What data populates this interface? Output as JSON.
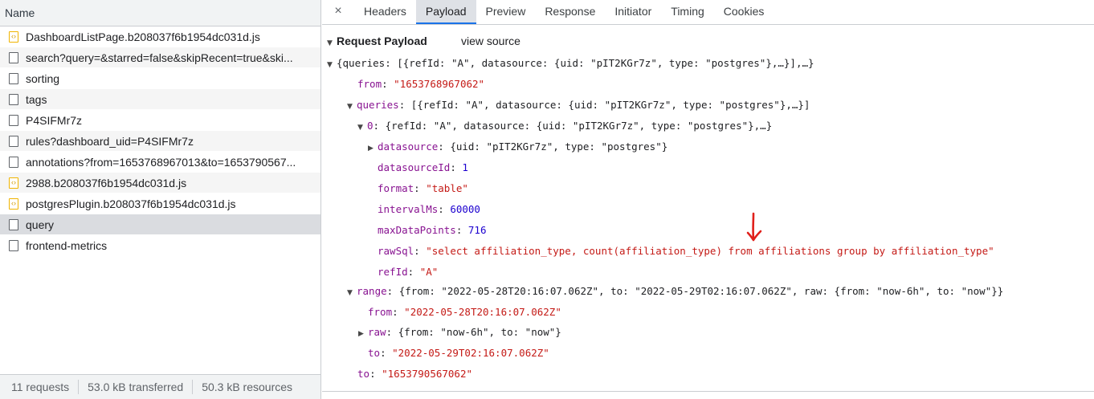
{
  "left_panel": {
    "header": "Name",
    "requests": [
      {
        "name": "DashboardListPage.b208037f6b1954dc031d.js",
        "icon": "js-file-icon"
      },
      {
        "name": "search?query=&starred=false&skipRecent=true&ski...",
        "icon": "document-icon"
      },
      {
        "name": "sorting",
        "icon": "document-icon"
      },
      {
        "name": "tags",
        "icon": "document-icon"
      },
      {
        "name": "P4SIFMr7z",
        "icon": "document-icon"
      },
      {
        "name": "rules?dashboard_uid=P4SIFMr7z",
        "icon": "document-icon"
      },
      {
        "name": "annotations?from=1653768967013&to=1653790567...",
        "icon": "document-icon"
      },
      {
        "name": "2988.b208037f6b1954dc031d.js",
        "icon": "js-file-icon"
      },
      {
        "name": "postgresPlugin.b208037f6b1954dc031d.js",
        "icon": "js-file-icon"
      },
      {
        "name": "query",
        "icon": "document-icon",
        "selected": true
      },
      {
        "name": "frontend-metrics",
        "icon": "document-icon"
      }
    ],
    "status": {
      "requests": "11 requests",
      "transferred": "53.0 kB transferred",
      "resources": "50.3 kB resources"
    }
  },
  "tabs": {
    "close": "×",
    "items": [
      "Headers",
      "Payload",
      "Preview",
      "Response",
      "Initiator",
      "Timing",
      "Cookies"
    ],
    "active": "Payload"
  },
  "payload": {
    "section_title": "Request Payload",
    "view_source": "view source",
    "summary": "{queries: [{refId: \"A\", datasource: {uid: \"pIT2KGr7z\", type: \"postgres\"},…}],…}",
    "from": {
      "key": "from",
      "value": "\"1653768967062\""
    },
    "queries": {
      "key": "queries",
      "value": "[{refId: \"A\", datasource: {uid: \"pIT2KGr7z\", type: \"postgres\"},…}]"
    },
    "query0": {
      "key": "0",
      "value": "{refId: \"A\", datasource: {uid: \"pIT2KGr7z\", type: \"postgres\"},…}"
    },
    "datasource": {
      "key": "datasource",
      "value": "{uid: \"pIT2KGr7z\", type: \"postgres\"}"
    },
    "datasourceId": {
      "key": "datasourceId",
      "value": "1"
    },
    "format": {
      "key": "format",
      "value": "\"table\""
    },
    "intervalMs": {
      "key": "intervalMs",
      "value": "60000"
    },
    "maxDataPoints": {
      "key": "maxDataPoints",
      "value": "716"
    },
    "rawSql": {
      "key": "rawSql",
      "value": "\"select affiliation_type, count(affiliation_type) from affiliations group by affiliation_type\""
    },
    "refId": {
      "key": "refId",
      "value": "\"A\""
    },
    "range": {
      "key": "range",
      "value": "{from: \"2022-05-28T20:16:07.062Z\", to: \"2022-05-29T02:16:07.062Z\", raw: {from: \"now-6h\", to: \"now\"}}"
    },
    "range_from": {
      "key": "from",
      "value": "\"2022-05-28T20:16:07.062Z\""
    },
    "raw": {
      "key": "raw",
      "value": "{from: \"now-6h\", to: \"now\"}"
    },
    "range_to": {
      "key": "to",
      "value": "\"2022-05-29T02:16:07.062Z\""
    },
    "to": {
      "key": "to",
      "value": "\"1653790567062\""
    }
  },
  "colors": {
    "key": "#881391",
    "string": "#c41a16",
    "number": "#1c00cf",
    "active_tab_underline": "#1a73e8",
    "annotation_arrow": "#e0201b"
  }
}
